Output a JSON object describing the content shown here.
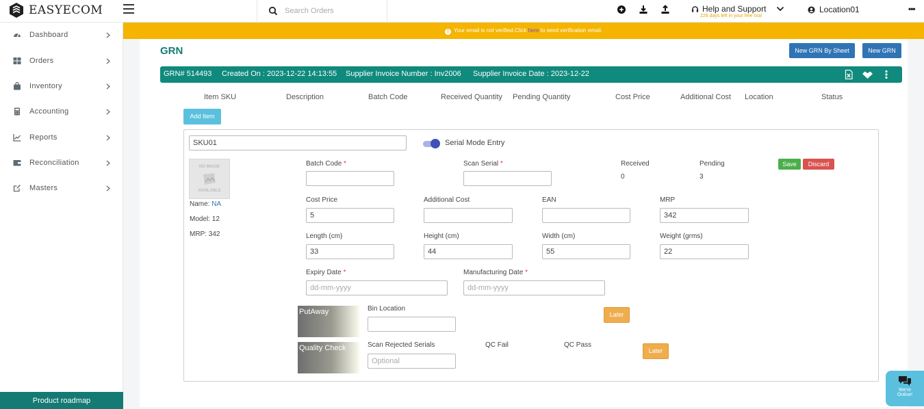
{
  "brand": {
    "name": "EASYECOM"
  },
  "topbar": {
    "search_placeholder": "Search Orders",
    "icons": [
      "plus-circle-icon",
      "download-icon",
      "upload-icon"
    ],
    "help_label": "Help and Support",
    "trial_text": "226 days left in your free trial",
    "location_label": "Location01"
  },
  "sidebar": {
    "items": [
      {
        "label": "Dashboard",
        "icon": "dashboard-icon"
      },
      {
        "label": "Orders",
        "icon": "grid-icon"
      },
      {
        "label": "Inventory",
        "icon": "bag-icon"
      },
      {
        "label": "Accounting",
        "icon": "calculator-icon"
      },
      {
        "label": "Reports",
        "icon": "line-chart-icon"
      },
      {
        "label": "Reconciliation",
        "icon": "wallet-icon"
      },
      {
        "label": "Masters",
        "icon": "edit-square-icon"
      }
    ],
    "footer": "Product roadmap"
  },
  "banner": {
    "text_before": "Your email is not verified.Click ",
    "link": "here",
    "text_after": " to send verification email."
  },
  "page": {
    "title": "GRN",
    "btn_sheet": "New GRN By Sheet",
    "btn_new": "New GRN"
  },
  "grn": {
    "number": "GRN# 514493",
    "created": "Created On : 2023-12-22 14:13:55",
    "invoice_no": "Supplier Invoice Number : Inv2006",
    "invoice_date": "Supplier Invoice Date : 2023-12-22"
  },
  "columns": [
    "Item SKU",
    "Description",
    "Batch Code",
    "Received Quantity",
    "Pending Quantity",
    "Cost Price",
    "Additional Cost",
    "Location",
    "Status"
  ],
  "add_item": "Add Item",
  "item": {
    "sku": "SKU01",
    "serial_mode": "Serial Mode Entry",
    "serial_mode_on": true,
    "noimg_top": "NO IMAGE",
    "noimg_bottom": "AVAILABLE",
    "name_label": "Name:",
    "name_value": "NA",
    "model": "Model: 12",
    "mrp_info": "MRP: 342",
    "batch_code_label": "Batch Code",
    "scan_serial_label": "Scan Serial",
    "received_label": "Received",
    "received_value": "0",
    "pending_label": "Pending",
    "pending_value": "3",
    "save": "Save",
    "discard": "Discard",
    "cost_price_label": "Cost Price",
    "cost_price": "5",
    "additional_cost_label": "Additional Cost",
    "additional_cost": "",
    "ean_label": "EAN",
    "ean": "",
    "mrp_label": "MRP",
    "mrp": "342",
    "length_label": "Length (cm)",
    "length": "33",
    "height_label": "Height (cm)",
    "height": "44",
    "width_label": "Width (cm)",
    "width": "55",
    "weight_label": "Weight (grms)",
    "weight": "22",
    "expiry_label": "Expiry Date",
    "mfg_label": "Manufacturing Date",
    "date_placeholder": "dd-mm-yyyy",
    "putaway": "PutAway",
    "bin_location_label": "Bin Location",
    "later": "Later",
    "quality_check": "Quality Check",
    "scan_rejected_label": "Scan Rejected Serials",
    "scan_rejected_placeholder": "Optional",
    "qc_fail": "QC Fail",
    "qc_pass": "QC Pass"
  },
  "chat": {
    "line1": "We're",
    "line2": "Online!"
  },
  "colors": {
    "teal": "#0f8a7c",
    "warning": "#f5b400",
    "primary": "#2f74b5"
  }
}
